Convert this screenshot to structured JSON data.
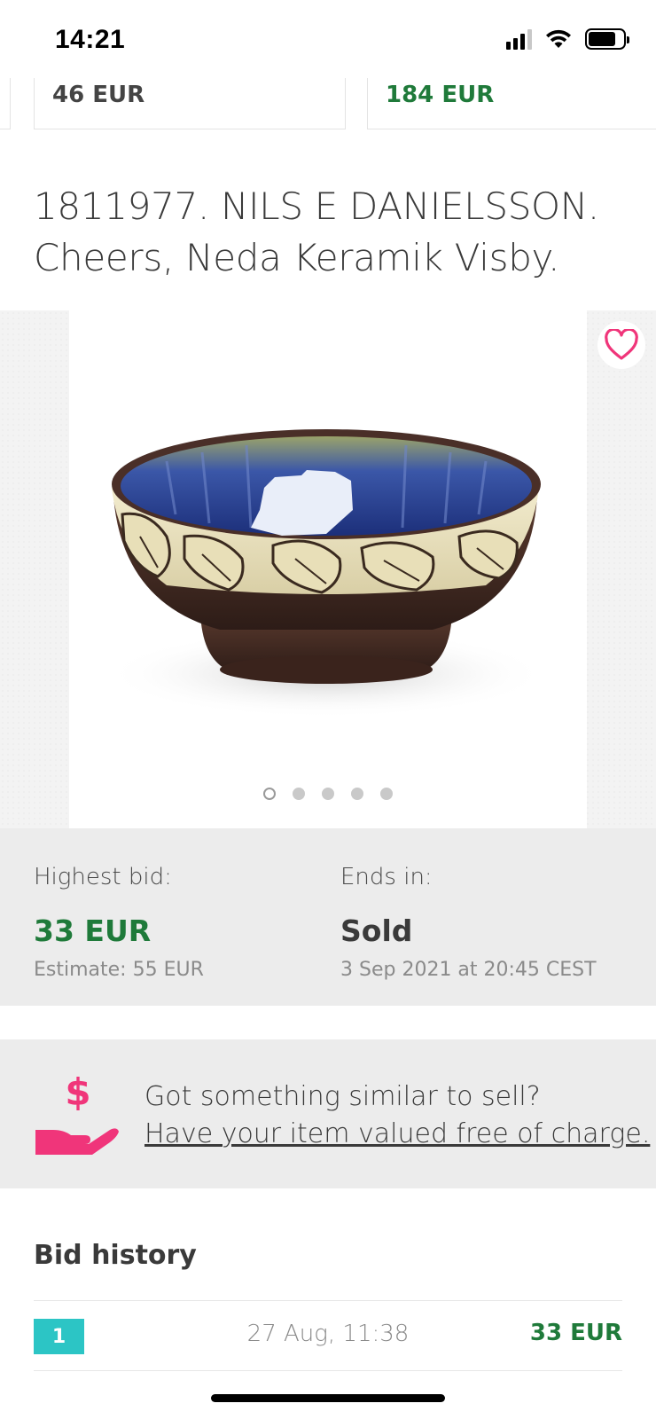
{
  "status_bar": {
    "time": "14:21",
    "battery_level": 0.78
  },
  "related_items": [
    {
      "price": "46 EUR",
      "color": "#444444"
    },
    {
      "price": "184 EUR",
      "color": "#1f7a3a"
    }
  ],
  "item": {
    "title": "1811977. NILS E DANIELSSON. Cheers, Neda Keramik Visby.",
    "image_icon": "ceramic-bowl-photo",
    "favorite_icon": "heart-outline-icon",
    "gallery_count": 5,
    "gallery_active_index": 0
  },
  "bid_info": {
    "highest_label": "Highest bid:",
    "highest_value": "33 EUR",
    "estimate": "Estimate: 55 EUR",
    "ends_label": "Ends in:",
    "ends_value": "Sold",
    "ends_date": "3 Sep 2021 at 20:45 CEST"
  },
  "sell_banner": {
    "icon": "dollar-hand-icon",
    "question": "Got something similar to sell?",
    "link": "Have your item valued free of charge."
  },
  "bid_history": {
    "title": "Bid history",
    "rows": [
      {
        "number": "1",
        "date": "27 Aug, 11:38",
        "amount": "33 EUR"
      }
    ]
  },
  "colors": {
    "accent_pink": "#f0357a",
    "price_green": "#1f7a3a",
    "bidder_teal": "#2cc5c5"
  }
}
